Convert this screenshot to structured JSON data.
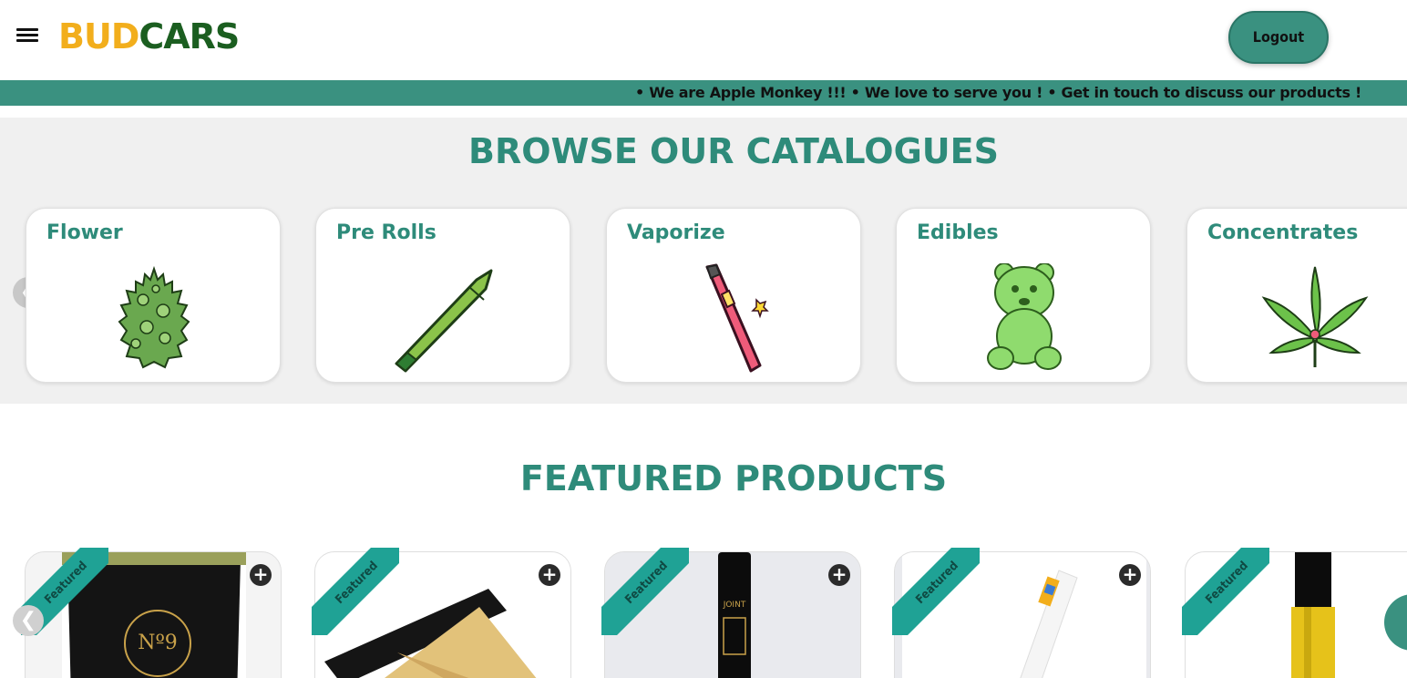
{
  "header": {
    "menu_icon": "hamburger-menu-icon",
    "logo_part1": "BUD",
    "logo_part2": "CARS",
    "logout_label": "Logout"
  },
  "ticker": {
    "text": "• We are Apple Monkey !!! • We love to serve you ! • Get in touch to discuss our products !"
  },
  "catalogue": {
    "title": "BROWSE OUR CATALOGUES",
    "prev_icon": "chevron-left-icon",
    "items": [
      {
        "label": "Flower",
        "icon": "flower-bud-icon"
      },
      {
        "label": "Pre Rolls",
        "icon": "pre-roll-icon"
      },
      {
        "label": "Vaporize",
        "icon": "vape-pen-icon"
      },
      {
        "label": "Edibles",
        "icon": "gummy-bear-icon"
      },
      {
        "label": "Concentrates",
        "icon": "cannabis-leaf-icon"
      }
    ]
  },
  "featured": {
    "title": "FEATURED PRODUCTS",
    "prev_icon": "chevron-left-icon",
    "ribbon_label": "Featured",
    "add_icon": "plus-circle-icon",
    "products": [
      {
        "image": "sunflower-bag-photo",
        "package_text": "Nº9"
      },
      {
        "image": "pre-roll-tube-photo"
      },
      {
        "image": "joint-tube-photo",
        "package_text": "JOINT"
      },
      {
        "image": "vape-cart-white-photo"
      },
      {
        "image": "vape-cart-yellow-photo"
      }
    ]
  },
  "colors": {
    "accent": "#3a9180",
    "title_teal": "#2e8b7a",
    "ribbon": "#1fa295",
    "logo_orange": "#f2ae1c",
    "logo_green": "#1b5e20"
  }
}
